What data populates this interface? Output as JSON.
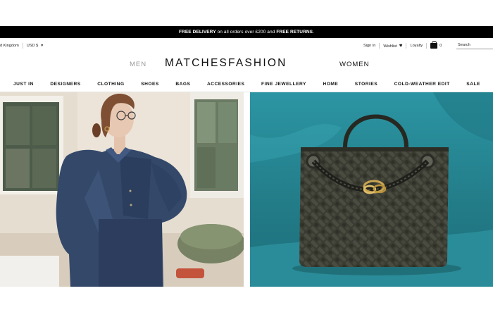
{
  "promo": {
    "part1": "FREE DELIVERY",
    "part2": " on all orders over £200 and ",
    "part3": "FREE RETURNS",
    "part4": "."
  },
  "utility": {
    "country": "d Kingdom",
    "currency": "USD $",
    "sign_in": "Sign In",
    "wishlist": "Wishlist",
    "loyalty": "Loyalty",
    "bag_count": "0",
    "search_placeholder": "Search"
  },
  "header": {
    "men": "MEN",
    "logo": "MATCHESFASHION",
    "women": "WOMEN"
  },
  "nav": {
    "items": [
      "JUST IN",
      "DESIGNERS",
      "CLOTHING",
      "SHOES",
      "BAGS",
      "ACCESSORIES",
      "FINE JEWELLERY",
      "HOME",
      "STORIES",
      "COLD-WEATHER EDIT",
      "SALE"
    ]
  },
  "colors": {
    "promo_bg": "#000000",
    "right_hero_bg": "#2a8d99",
    "bag_color": "#3c3d33"
  }
}
